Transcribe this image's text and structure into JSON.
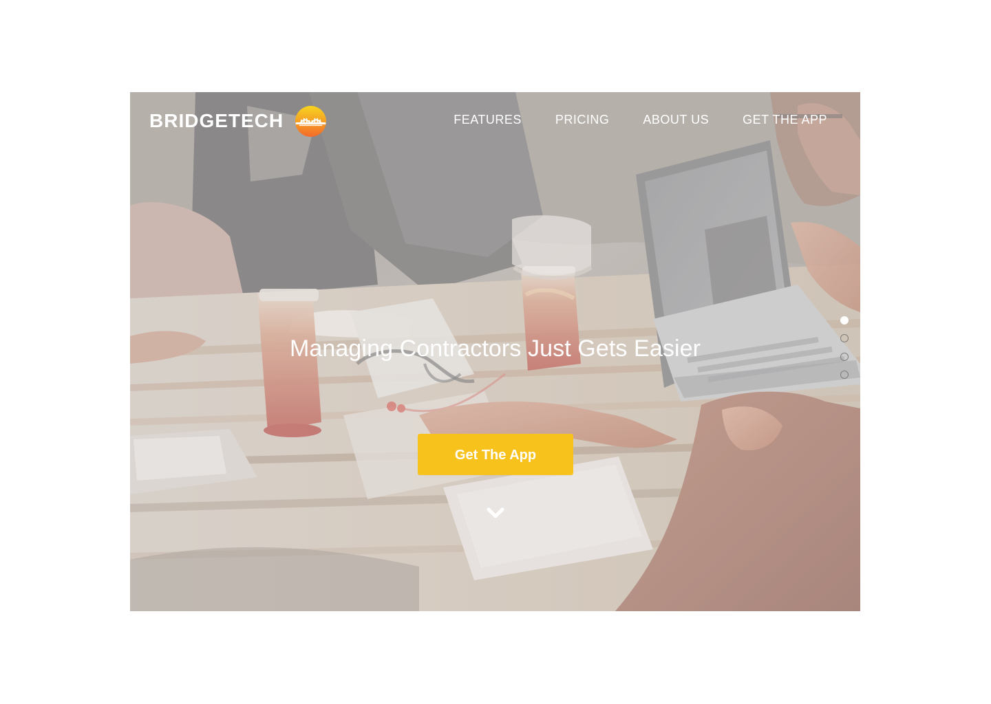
{
  "brand": {
    "name": "BRIDGETECH",
    "logo_icon": "bridge-icon"
  },
  "nav": {
    "items": [
      {
        "label": "FEATURES"
      },
      {
        "label": "PRICING"
      },
      {
        "label": "ABOUT US"
      },
      {
        "label": "GET THE APP"
      }
    ]
  },
  "hero": {
    "headline": "Managing Contractors Just Gets Easier",
    "cta_label": "Get The App",
    "scroll_icon": "chevron-down-icon"
  },
  "slider": {
    "slide_count": 4,
    "active_slide": 1
  },
  "colors": {
    "accent": "#F8C21D",
    "text_on_image": "#FFFFFF",
    "logo_gradient_top": "#F6D51F",
    "logo_gradient_bottom": "#F46A2A"
  }
}
